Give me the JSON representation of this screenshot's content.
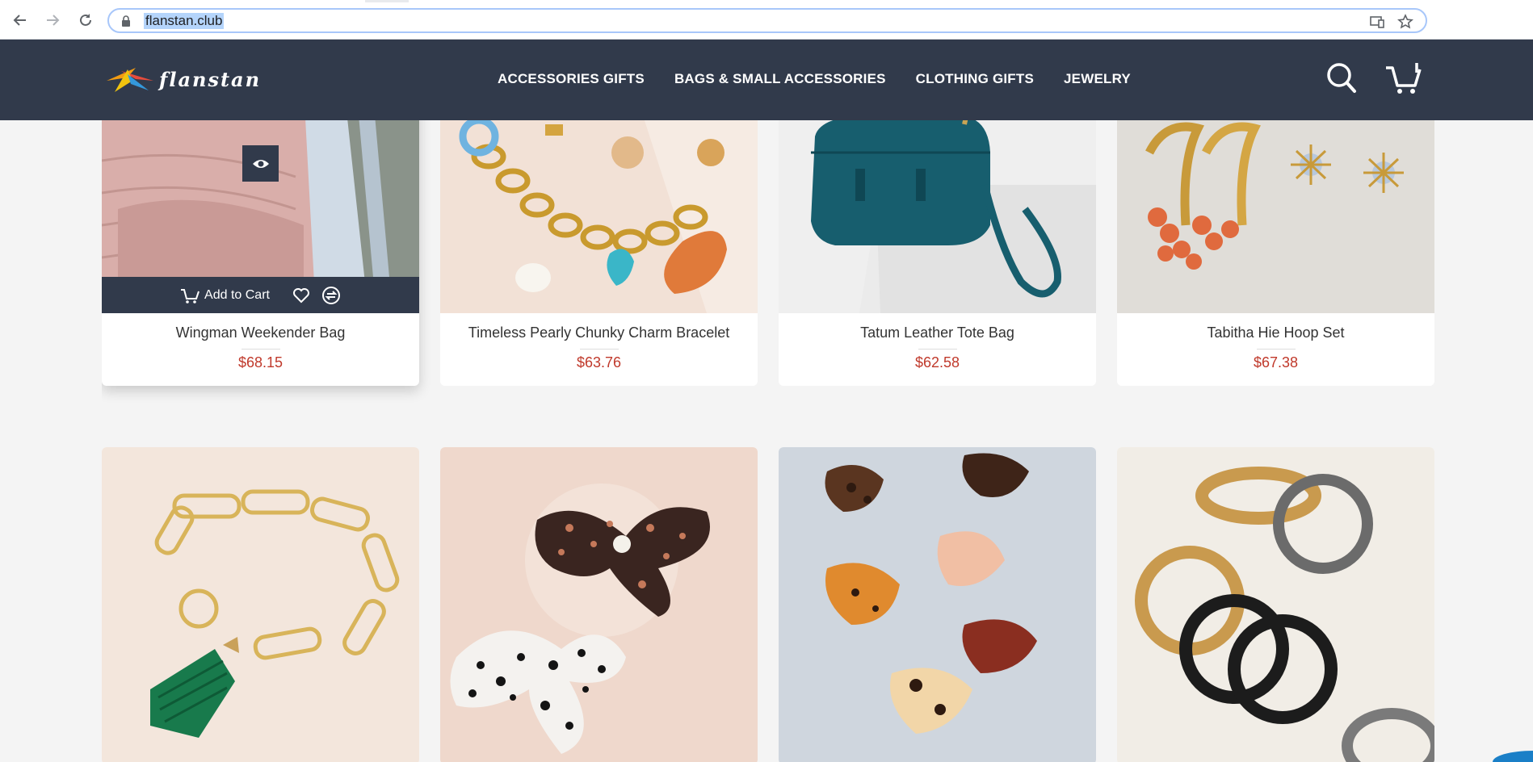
{
  "browser": {
    "url": "flanstan.club",
    "back_icon": "arrow-left-icon",
    "forward_icon": "arrow-right-icon",
    "reload_icon": "reload-icon",
    "lock_icon": "lock-icon",
    "install_icon": "cast-device-icon",
    "bookmark_icon": "star-icon"
  },
  "header": {
    "logo_text": "flanstan",
    "nav": [
      {
        "label": "ACCESSORIES GIFTS"
      },
      {
        "label": "BAGS & SMALL ACCESSORIES"
      },
      {
        "label": "CLOTHING GIFTS"
      },
      {
        "label": "JEWELRY"
      }
    ],
    "search_icon": "search-icon",
    "cart_icon": "cart-icon"
  },
  "products": [
    {
      "name": "Wingman Weekender Bag",
      "price": "$68.15"
    },
    {
      "name": "Timeless Pearly Chunky Charm Bracelet",
      "price": "$63.76"
    },
    {
      "name": "Tatum Leather Tote Bag",
      "price": "$62.58"
    },
    {
      "name": "Tabitha Hie Hoop Set",
      "price": "$67.38"
    },
    {
      "name": "",
      "price": ""
    },
    {
      "name": "",
      "price": ""
    },
    {
      "name": "",
      "price": ""
    },
    {
      "name": "",
      "price": ""
    }
  ],
  "hover_actions": {
    "add_to_cart": "Add to Cart",
    "wishlist_icon": "heart-icon",
    "compare_icon": "compare-icon",
    "quick_view_icon": "eye-icon"
  },
  "colors": {
    "header_bg": "#313a4b",
    "price": "#c0392b",
    "page_bg": "#f4f4f4"
  }
}
